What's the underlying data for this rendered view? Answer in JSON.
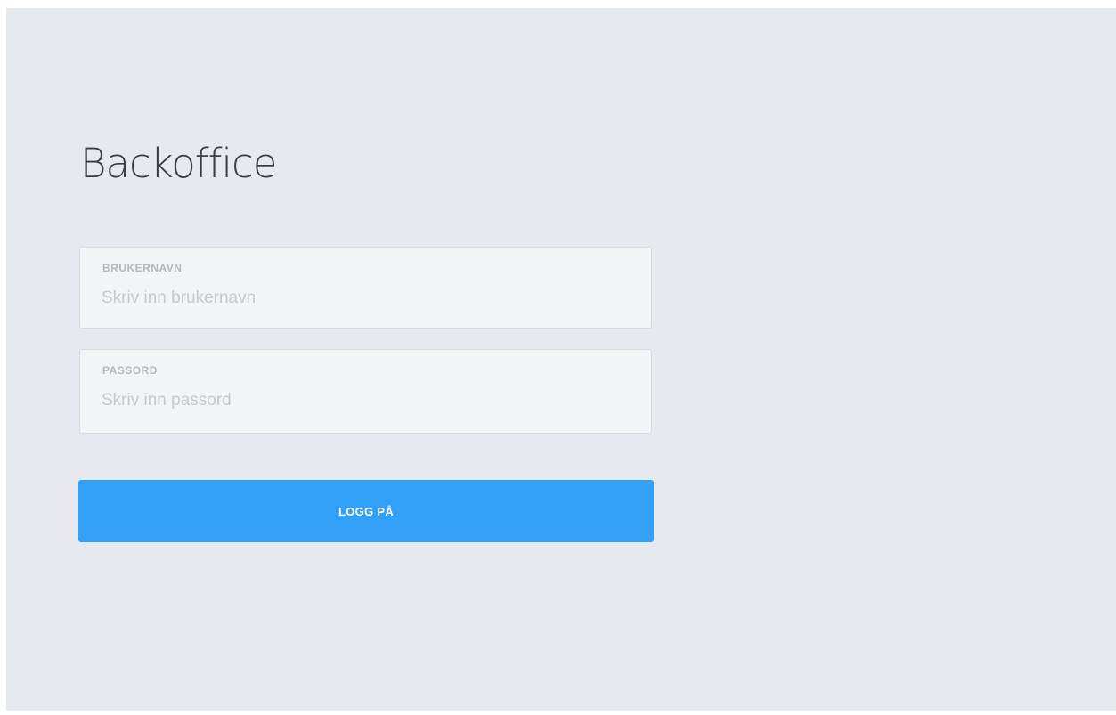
{
  "login": {
    "title": "Backoffice",
    "username": {
      "label": "BRUKERNAVN",
      "placeholder": "Skriv inn brukernavn",
      "value": ""
    },
    "password": {
      "label": "PASSORD",
      "placeholder": "Skriv inn passord",
      "value": ""
    },
    "submit_label": "LOGG PÅ"
  },
  "colors": {
    "background": "#e6e9ee",
    "field_background": "#f2f4f6",
    "accent": "#33a0f7"
  }
}
